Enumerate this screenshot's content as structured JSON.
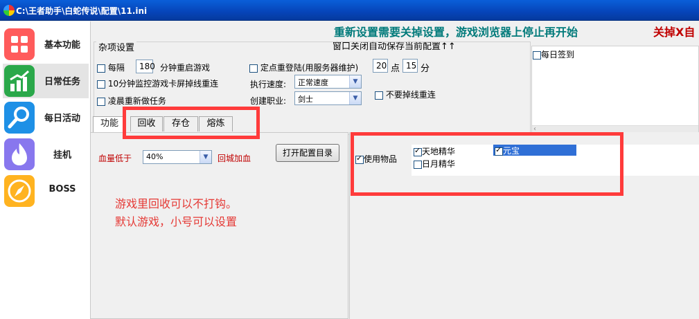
{
  "window": {
    "title": "C:\\王者助手\\白蛇传说\\配置\\11.ini"
  },
  "sidebar": {
    "items": [
      {
        "label": "基本功能",
        "icon": "grid-icon"
      },
      {
        "label": "日常任务",
        "icon": "bar-chart-icon"
      },
      {
        "label": "每日活动",
        "icon": "search-icon"
      },
      {
        "label": "挂机",
        "icon": "flame-icon"
      },
      {
        "label": "BOSS",
        "icon": "compass-icon"
      }
    ]
  },
  "header": {
    "notice": "重新设置需要关掉设置，游戏浏览器上停止再开始",
    "close_hint": "关掉X自",
    "autosave": "窗口关闭自动保存当前配置↑↑"
  },
  "misc": {
    "group_title": "杂项设置",
    "every_label": "每隔",
    "every_value": "180",
    "restart_label": "分钟重启游戏",
    "monitor_label": "10分钟监控游戏卡屏掉线重连",
    "dawn_label": "凌晨重新做任务",
    "timed_login_label": "定点重登陆(用服务器维护)",
    "hour_value": "20",
    "hour_unit": "点",
    "minute_value": "15",
    "minute_unit": "分",
    "speed_label": "执行速度:",
    "speed_value": "正常速度",
    "job_label": "创建职业:",
    "job_value": "剑士",
    "no_reconnect_label": "不要掉线重连",
    "signin_label": "每日签到"
  },
  "tabs": [
    {
      "label": "功能"
    },
    {
      "label": "回收"
    },
    {
      "label": "存仓"
    },
    {
      "label": "熔炼"
    }
  ],
  "recycle": {
    "hp_label": "血量低于",
    "hp_value": "40%",
    "return_label": "回城加血",
    "open_config_button": "打开配置目录",
    "note_line1": "游戏里回收可以不打钩。",
    "note_line2": "默认游戏，小号可以设置"
  },
  "items": {
    "use_label": "使用物品",
    "options": [
      {
        "label": "天地精华",
        "checked": true
      },
      {
        "label": "日月精华",
        "checked": false
      },
      {
        "label": "元宝",
        "checked": true
      }
    ]
  },
  "colors": {
    "accent": "#0a5fd9",
    "highlight": "#ff3b3b",
    "note": "#e53935"
  }
}
